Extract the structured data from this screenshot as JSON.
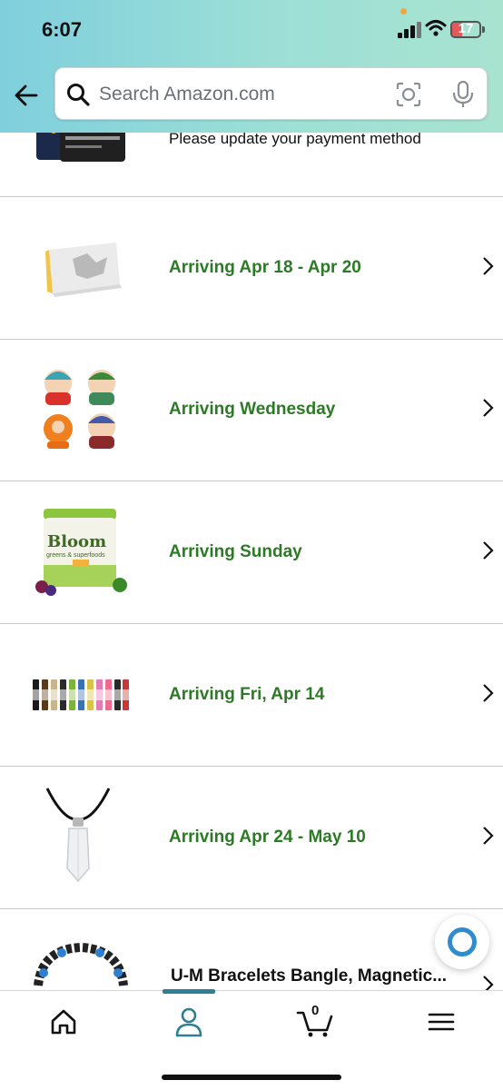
{
  "status_bar": {
    "time": "6:07",
    "battery": "17"
  },
  "search": {
    "placeholder": "Search Amazon.com"
  },
  "colors": {
    "accent": "#2c7a25",
    "header_start": "#7fcfdd",
    "header_end": "#a8e3cf",
    "tab_active": "#2e7f93",
    "alexa": "#2f8ccf"
  },
  "orders": {
    "top_message": "Please update your payment method",
    "items": [
      {
        "thumb": "pokemon-box-image",
        "status": "Arriving Apr 18 - Apr 20"
      },
      {
        "thumb": "south-park-figures-image",
        "status": "Arriving Wednesday"
      },
      {
        "thumb": "bloom-greens-image",
        "status": "Arriving Sunday"
      },
      {
        "thumb": "perfume-oils-image",
        "status": "Arriving Fri, Apr 14"
      },
      {
        "thumb": "crystal-necklace-image",
        "status": "Arriving Apr 24 - May 10"
      }
    ],
    "last_item": {
      "thumb": "bracelet-image",
      "title": "U-M Bracelets Bangle, Magnetic..."
    }
  },
  "product_label": {
    "bloom": "Bloom",
    "bloom_sub": "greens & superfoods"
  },
  "tabbar": {
    "cart_count": "0",
    "active": "account"
  }
}
